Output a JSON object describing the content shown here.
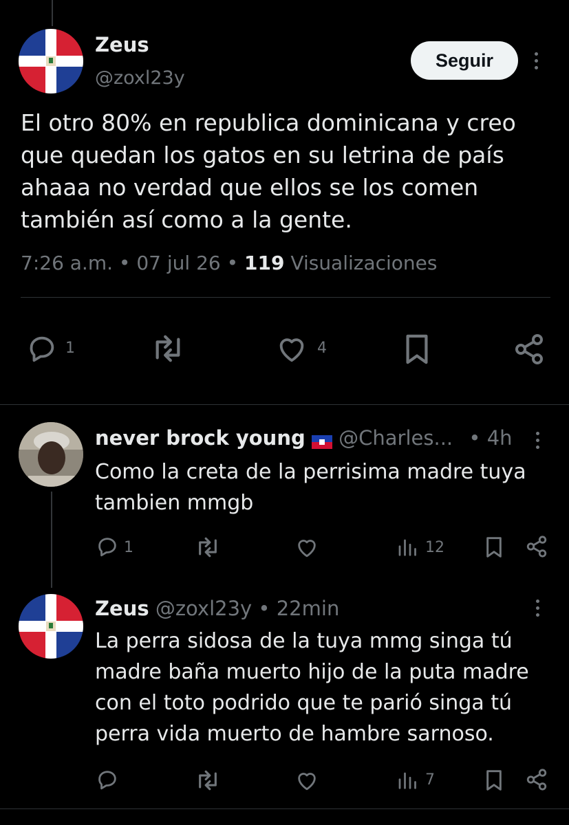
{
  "main_post": {
    "author_name": "Zeus",
    "author_handle": "@zoxl23y",
    "follow_label": "Seguir",
    "text": "El otro 80% en republica dominicana y creo que quedan los gatos en su letrina de país ahaaa no verdad que ellos se los comen también así como a la gente.",
    "time": "7:26 a.m.",
    "date": "07 jul 26",
    "views_count": "119",
    "views_label": "Visualizaciones",
    "reply_count": "1",
    "like_count": "4"
  },
  "replies": [
    {
      "author_name": "never brock young",
      "author_handle": "@Charles...",
      "time": "4h",
      "text": "Como la creta de  la perrisima madre tuya tambien mmgb",
      "reply_count": "1",
      "views_count": "12"
    },
    {
      "author_name": "Zeus",
      "author_handle": "@zoxl23y",
      "time": "22min",
      "text": "La perra sidosa de la tuya mmg singa tú madre baña muerto hijo de la puta madre con el toto podrido que te parió singa tú perra vida muerto de hambre sarnoso.",
      "views_count": "7"
    }
  ],
  "separator": "•",
  "colors": {
    "background": "#000000",
    "text": "#e7e9ea",
    "muted": "#71767b",
    "divider": "#2f3336",
    "flag_blue": "#1f3f95",
    "flag_red": "#d62133"
  },
  "icons": [
    "reply-icon",
    "repost-icon",
    "like-icon",
    "bookmark-icon",
    "share-icon",
    "views-icon",
    "more-options-icon",
    "haiti-flag-icon"
  ]
}
